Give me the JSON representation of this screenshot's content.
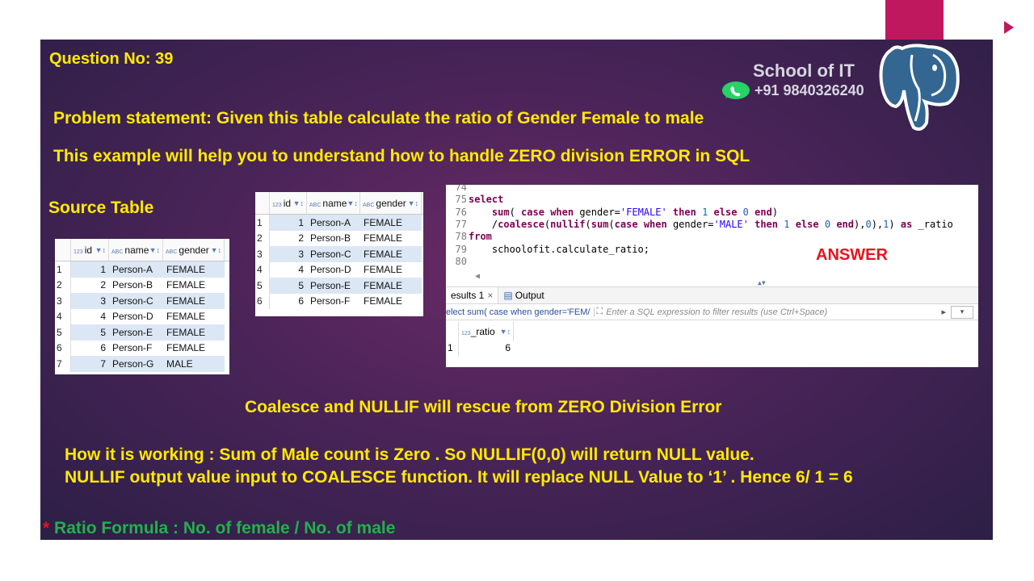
{
  "header": {
    "question": "Question No: 39",
    "problem": "Problem statement:  Given this table calculate the ratio of Gender Female  to male",
    "example": "This example will help you to understand how to handle ZERO division  ERROR in  SQL",
    "source_title": "Source Table"
  },
  "brand": {
    "name": "School of IT",
    "phone": "+91 9840326240",
    "whatsapp_icon": "whatsapp-icon",
    "logo_icon": "postgresql-elephant-icon",
    "accent": "#c0185e"
  },
  "grid_columns": {
    "id": "id",
    "name": "name",
    "gender": "gender",
    "num_tag": "123",
    "abc_tag": "ABC"
  },
  "source_table": {
    "rows": [
      {
        "rn": "1",
        "id": "1",
        "name": "Person-A",
        "gender": "FEMALE"
      },
      {
        "rn": "2",
        "id": "2",
        "name": "Person-B",
        "gender": "FEMALE"
      },
      {
        "rn": "3",
        "id": "3",
        "name": "Person-C",
        "gender": "FEMALE"
      },
      {
        "rn": "4",
        "id": "4",
        "name": "Person-D",
        "gender": "FEMALE"
      },
      {
        "rn": "5",
        "id": "5",
        "name": "Person-E",
        "gender": "FEMALE"
      },
      {
        "rn": "6",
        "id": "6",
        "name": "Person-F",
        "gender": "FEMALE"
      },
      {
        "rn": "7",
        "id": "7",
        "name": "Person-G",
        "gender": "MALE"
      }
    ]
  },
  "filtered_table": {
    "rows": [
      {
        "rn": "1",
        "id": "1",
        "name": "Person-A",
        "gender": "FEMALE"
      },
      {
        "rn": "2",
        "id": "2",
        "name": "Person-B",
        "gender": "FEMALE"
      },
      {
        "rn": "3",
        "id": "3",
        "name": "Person-C",
        "gender": "FEMALE"
      },
      {
        "rn": "4",
        "id": "4",
        "name": "Person-D",
        "gender": "FEMALE"
      },
      {
        "rn": "5",
        "id": "5",
        "name": "Person-E",
        "gender": "FEMALE"
      },
      {
        "rn": "6",
        "id": "6",
        "name": "Person-F",
        "gender": "FEMALE"
      }
    ]
  },
  "editor": {
    "lines": [
      {
        "n": "74",
        "code": ""
      },
      {
        "n": "75",
        "code": "select"
      },
      {
        "n": "76",
        "code": "    sum( case when gender='FEMALE' then 1 else 0 end)"
      },
      {
        "n": "77",
        "code": "    /coalesce(nullif(sum(case when gender='MALE' then 1 else 0 end),0),1) as _ratio"
      },
      {
        "n": "78",
        "code": "from"
      },
      {
        "n": "79",
        "code": "    schoolofit.calculate_ratio;"
      },
      {
        "n": "80",
        "code": ""
      }
    ],
    "answer": "ANSWER",
    "results_tab": "esults 1",
    "output_tab": "Output",
    "query_preview": "elect sum( case when gender='FEM/",
    "filter_placeholder": "Enter a SQL expression to filter results (use Ctrl+Space)",
    "result_column": "_ratio",
    "result_rn": "1",
    "result_value": "6"
  },
  "notes": {
    "rescue": "Coalesce and NULLIF will rescue from ZERO Division Error",
    "how1": "How it is working :   Sum of Male count is Zero .  So NULLIF(0,0) will return NULL value.",
    "how2": "NULLIF output value input to COALESCE function.  It will replace NULL Value to ‘1’ . Hence 6/ 1 = 6",
    "formula_star": "*",
    "formula": " Ratio Formula : No. of female / No. of male"
  },
  "colors": {
    "yellow": "#ffea00",
    "green": "#22b14c",
    "red": "#e8121e",
    "row_alt": "#dce7f5"
  }
}
